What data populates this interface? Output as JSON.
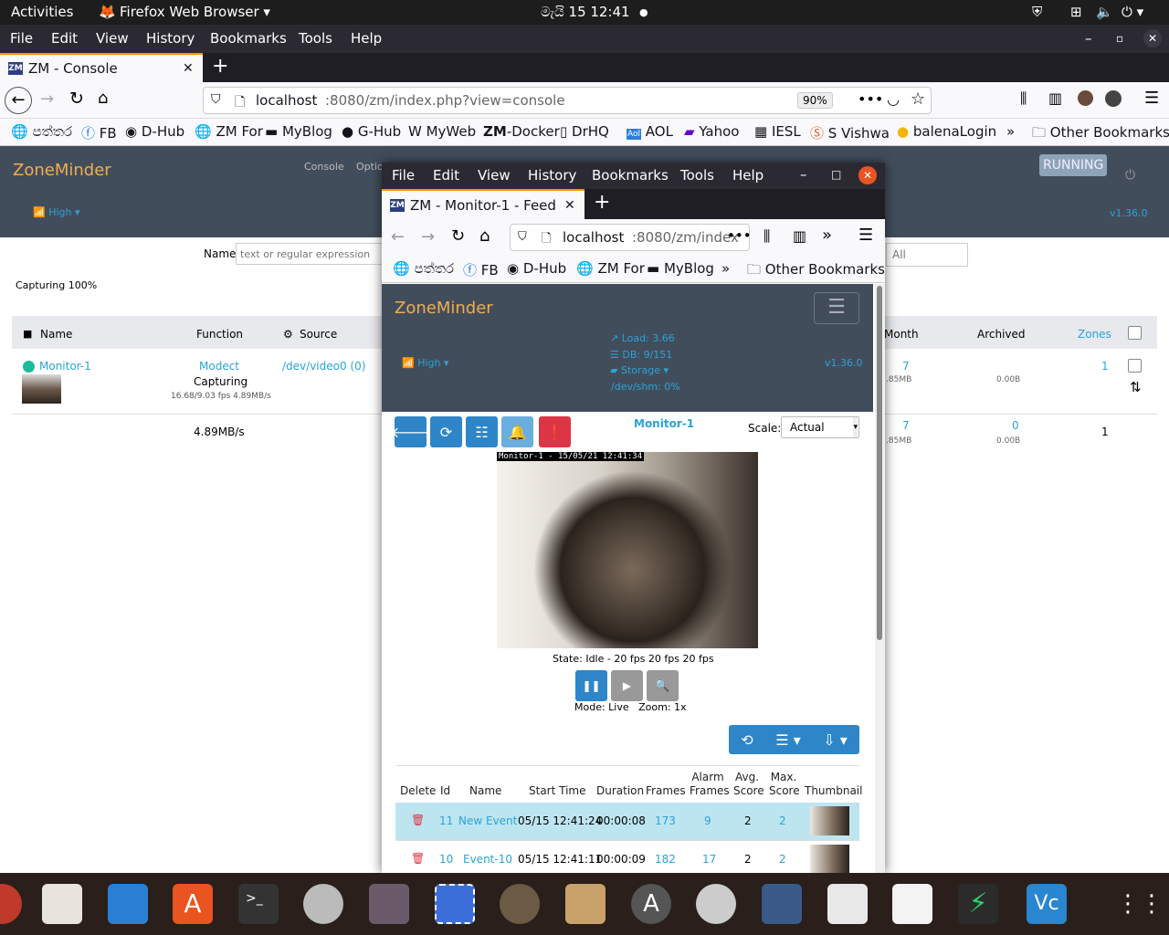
{
  "topbar": {
    "activities": "Activities",
    "app": "Firefox Web Browser ▾",
    "clock": "මැයි 15  12:41",
    "dot": "●"
  },
  "ff_menu": [
    "File",
    "Edit",
    "View",
    "History",
    "Bookmarks",
    "Tools",
    "Help"
  ],
  "tab": {
    "title": "ZM - Console",
    "close": "✕",
    "new": "+"
  },
  "url": {
    "host": "localhost",
    "rest": ":8080/zm/index.php?view=console",
    "zoom": "90%"
  },
  "bookmarks": [
    "පත්තර",
    "FB",
    "D-Hub",
    "ZM For",
    "MyBlog",
    "G-Hub",
    "MyWeb",
    "-Docker",
    "DrHQ",
    "AOL",
    "Yahoo",
    "IESL",
    "S Vishwa",
    "balenaLogin",
    "»",
    "Other Bookmarks"
  ],
  "console": {
    "brand": "ZoneMinder",
    "nav1": "Console",
    "nav2": "Optio",
    "running": "RUNNING",
    "bandwidth": "High ▾",
    "version": "v1.36.0",
    "filter_label": "Name",
    "filter_placeholder": "text or regular expression",
    "filter_all": "All",
    "capturing": "Capturing 100%",
    "headers": {
      "name": "Name",
      "function": "Function",
      "source": "Source",
      "month": "Month",
      "archived": "Archived",
      "zones": "Zones"
    },
    "row": {
      "name": "Monitor-1",
      "function": "Modect",
      "status": "Capturing",
      "fps": "16.68/9.03 fps 4.89MB/s",
      "source": "/dev/video0 (0)",
      "month": "7",
      "month_size": ".85MB",
      "archived_size": "0.00B",
      "zones": "1"
    },
    "totals": {
      "bw": "4.89MB/s",
      "month": "7",
      "month_size": ".85MB",
      "archived": "0",
      "archived_size": "0.00B",
      "zones": "1"
    }
  },
  "popup": {
    "menu": [
      "File",
      "Edit",
      "View",
      "History",
      "Bookmarks",
      "Tools",
      "Help"
    ],
    "tab": "ZM - Monitor-1 - Feed",
    "tab_close": "✕",
    "new": "+",
    "url_host": "localhost",
    "url_rest": ":8080/zm/index",
    "bookmarks": [
      "පත්තර",
      "FB",
      "D-Hub",
      "ZM For",
      "MyBlog",
      "»",
      "Other Bookmarks"
    ],
    "brand": "ZoneMinder",
    "load": "Load: 3.66",
    "db": "DB: 9/151",
    "storage": "Storage ▾",
    "shm": "/dev/shm: 0%",
    "bandwidth": "High ▾",
    "version": "v1.36.0",
    "monitor_title": "Monitor-1",
    "scale_label": "Scale:",
    "scale_value": "Actual",
    "overlay": "Monitor-1 - 15/05/21 12:41:34",
    "state": "State: Idle - 20 fps 20 fps 20 fps",
    "mode": "Mode: Live   Zoom: 1x",
    "headers": [
      "Delete",
      "Id",
      "Name",
      "Start Time",
      "Duration",
      "Frames",
      "Alarm Frames",
      "Avg. Score",
      "Max. Score",
      "Thumbnail"
    ],
    "events": [
      {
        "id": "11",
        "name": "New Event",
        "start": "05/15 12:41:24",
        "duration": "00:00:08",
        "frames": "173",
        "alarm": "9",
        "avg": "2",
        "max": "2"
      },
      {
        "id": "10",
        "name": "Event-10",
        "start": "05/15 12:41:11",
        "duration": "00:00:09",
        "frames": "182",
        "alarm": "17",
        "avg": "2",
        "max": "2"
      }
    ]
  },
  "colors": {
    "accent": "#2aa3d8",
    "brand": "#f0ad4e",
    "header": "#424d5c",
    "button": "#2e86c8",
    "danger": "#dc3545",
    "rowhl": "#bde5f0"
  }
}
